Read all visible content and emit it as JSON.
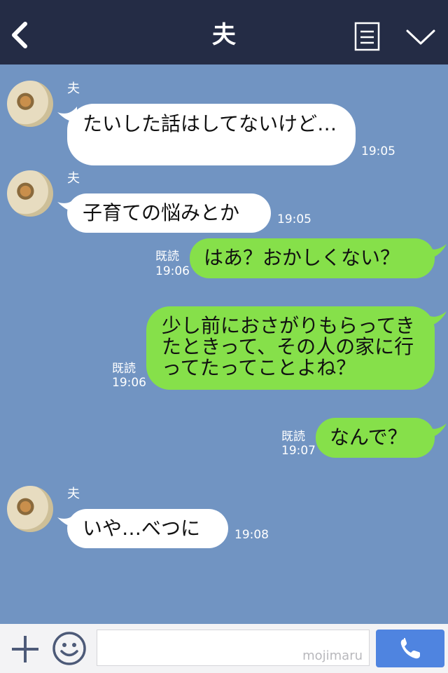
{
  "header": {
    "title": "夫"
  },
  "chat": {
    "messages": [
      {
        "sender": "夫",
        "text": "たいした話はしてないけど…",
        "time": "19:05",
        "direction": "in"
      },
      {
        "sender": "夫",
        "text": "子育ての悩みとか",
        "time": "19:05",
        "direction": "in"
      },
      {
        "text": "はあ？おかしくない？",
        "read": "既読",
        "time": "19:06",
        "direction": "out"
      },
      {
        "text": "少し前におさがりもらってきたときって、その人の家に行ってたってことよね？",
        "read": "既読",
        "time": "19:06",
        "direction": "out"
      },
      {
        "text": "なんで？",
        "read": "既読",
        "time": "19:07",
        "direction": "out"
      },
      {
        "sender": "夫",
        "text": "いや…べつに",
        "time": "19:08",
        "direction": "in"
      }
    ]
  },
  "input": {
    "value": "",
    "watermark": "mojimaru"
  },
  "colors": {
    "header_bg": "#242c45",
    "chat_bg": "#7194c2",
    "incoming_bubble": "#ffffff",
    "outgoing_bubble": "#86e04a",
    "call_button": "#4f84e0"
  },
  "icons": {
    "back": "chevron-left-icon",
    "note": "note-icon",
    "menu": "chevron-down-icon",
    "plus": "plus-icon",
    "emoji": "smiley-icon",
    "call": "phone-icon"
  }
}
